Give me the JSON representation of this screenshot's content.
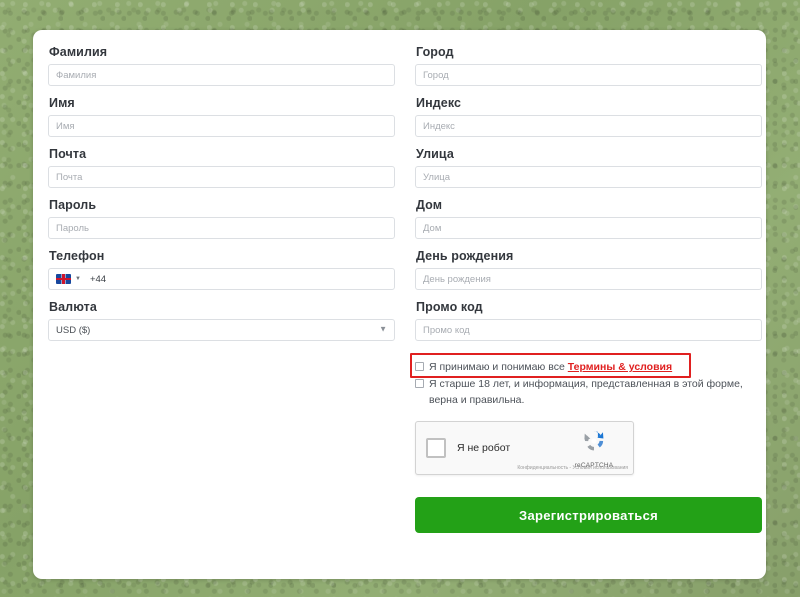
{
  "form": {
    "left_fields": [
      {
        "label": "Фамилия",
        "placeholder": "Фамилия",
        "type": "text"
      },
      {
        "label": "Имя",
        "placeholder": "Имя",
        "type": "text"
      },
      {
        "label": "Почта",
        "placeholder": "Почта",
        "type": "text"
      },
      {
        "label": "Пароль",
        "placeholder": "Пароль",
        "type": "password"
      }
    ],
    "phone": {
      "label": "Телефон",
      "flag_icon": "uk-flag-icon",
      "dial_code": "+44",
      "caret_icon": "chevron-down-icon"
    },
    "currency": {
      "label": "Валюта",
      "selected": "USD ($)",
      "caret_icon": "chevron-down-icon"
    },
    "right_fields": [
      {
        "label": "Город",
        "placeholder": "Город"
      },
      {
        "label": "Индекс",
        "placeholder": "Индекс"
      },
      {
        "label": "Улица",
        "placeholder": "Улица"
      },
      {
        "label": "Дом",
        "placeholder": "Дом"
      },
      {
        "label": "День рождения",
        "placeholder": "День рождения"
      },
      {
        "label": "Промо код",
        "placeholder": "Промо код"
      }
    ],
    "agreements": {
      "terms": {
        "text": "Я принимаю и понимаю все",
        "link": "Термины & условия"
      },
      "age": {
        "text": "Я старше 18 лет, и информация, представленная в этой форме, верна и правильна."
      },
      "highlight_color": "#e02020"
    },
    "recaptcha": {
      "label": "Я не робот",
      "brand": "reCAPTCHA",
      "fine_print": "Конфиденциальность - Условия использования",
      "logo_icon": "recaptcha-logo-icon"
    },
    "submit": {
      "label": "Зарегистрироваться",
      "color": "#23a117"
    }
  }
}
